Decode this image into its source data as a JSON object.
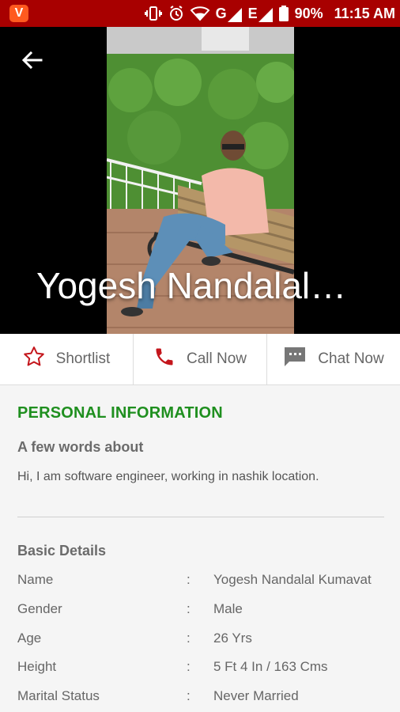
{
  "status_bar": {
    "app_badge": "V",
    "network_label": "G",
    "network_label_2": "E",
    "battery": "90%",
    "time": "11:15 AM"
  },
  "profile": {
    "name": "Yogesh Nandalal…"
  },
  "actions": [
    {
      "label": "Shortlist",
      "icon": "star-icon"
    },
    {
      "label": "Call Now",
      "icon": "phone-icon"
    },
    {
      "label": "Chat Now",
      "icon": "chat-icon"
    }
  ],
  "personal_info": {
    "title": "PERSONAL INFORMATION",
    "about_heading": "A few words about",
    "about_text": "Hi,  I am software engineer,  working in nashik location."
  },
  "basic_details": {
    "heading": "Basic Details",
    "rows": [
      {
        "label": "Name",
        "value": "Yogesh Nandalal Kumavat"
      },
      {
        "label": "Gender",
        "value": "Male"
      },
      {
        "label": "Age",
        "value": "26 Yrs"
      },
      {
        "label": "Height",
        "value": "5 Ft 4 In / 163 Cms"
      },
      {
        "label": "Marital Status",
        "value": "Never Married"
      }
    ]
  },
  "colors": {
    "status_bar": "#a80000",
    "accent_red": "#c4161c",
    "section_green": "#1f8f1f"
  }
}
